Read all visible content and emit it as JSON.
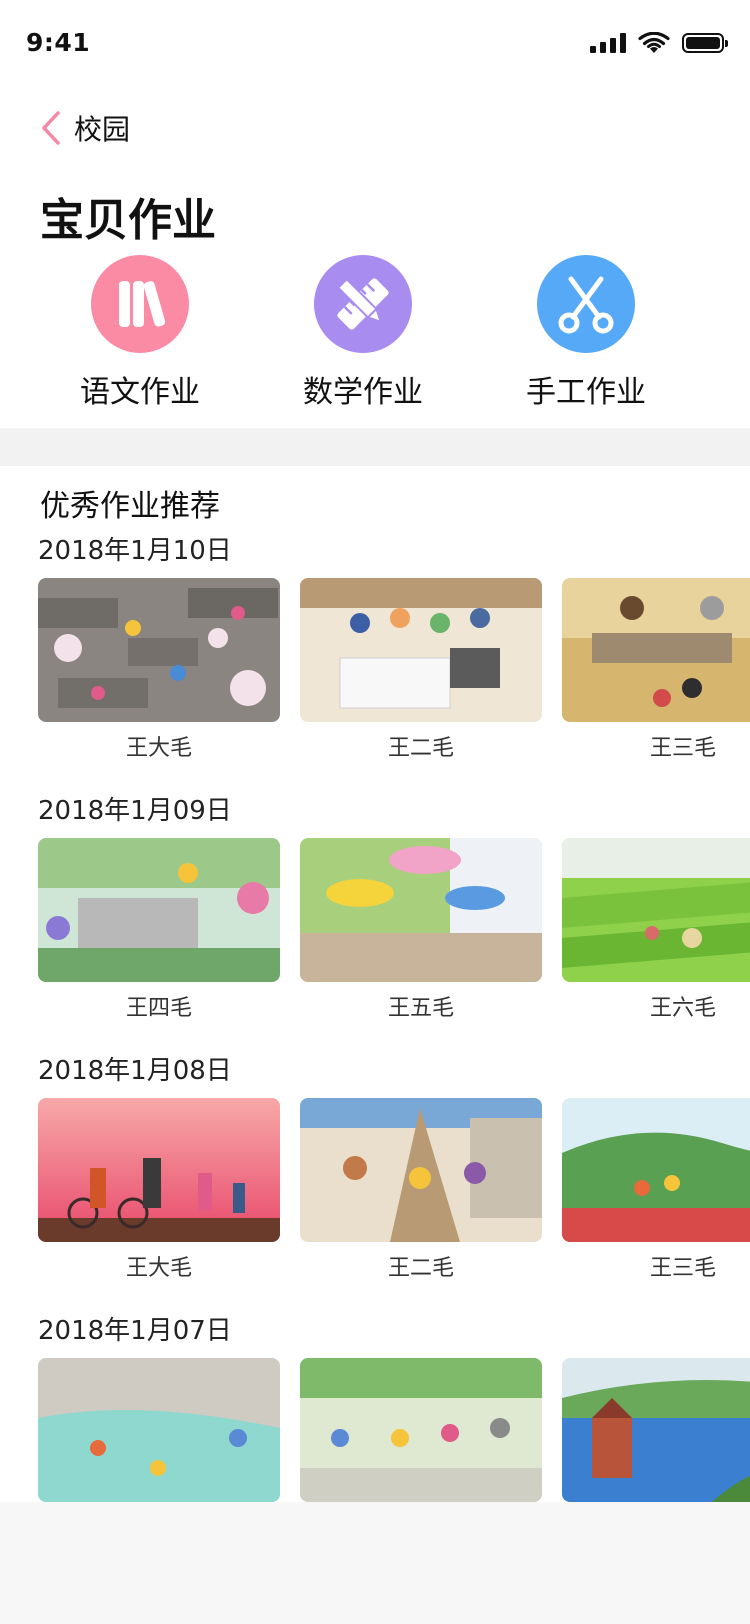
{
  "status": {
    "time": "9:41"
  },
  "nav": {
    "back_label": "校园"
  },
  "page_title": "宝贝作业",
  "categories": [
    {
      "label": "语文作业",
      "icon": "books-icon",
      "color": "#fb8aa5"
    },
    {
      "label": "数学作业",
      "icon": "pencil-ruler-icon",
      "color": "#a98cf0"
    },
    {
      "label": "手工作业",
      "icon": "scissors-icon",
      "color": "#56a9f7"
    }
  ],
  "section_title": "优秀作业推荐",
  "days": [
    {
      "date": "2018年1月10日",
      "items": [
        {
          "name": "王大毛"
        },
        {
          "name": "王二毛"
        },
        {
          "name": "王三毛"
        }
      ]
    },
    {
      "date": "2018年1月09日",
      "items": [
        {
          "name": "王四毛"
        },
        {
          "name": "王五毛"
        },
        {
          "name": "王六毛"
        }
      ]
    },
    {
      "date": "2018年1月08日",
      "items": [
        {
          "name": "王大毛"
        },
        {
          "name": "王二毛"
        },
        {
          "name": "王三毛"
        }
      ]
    },
    {
      "date": "2018年1月07日",
      "items": [
        {
          "name": ""
        },
        {
          "name": ""
        },
        {
          "name": ""
        }
      ]
    }
  ],
  "colors": {
    "accent_back": "#f58aa6",
    "divider": "#f2f2f2"
  }
}
